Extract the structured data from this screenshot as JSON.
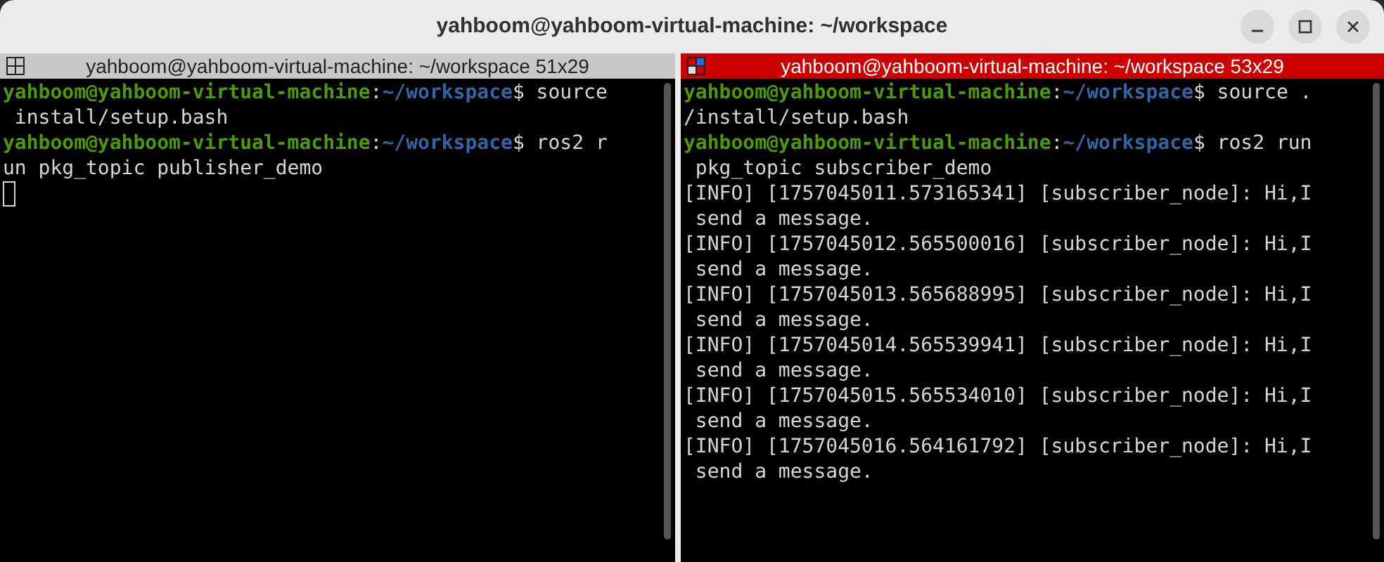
{
  "window": {
    "title": "yahboom@yahboom-virtual-machine: ~/workspace"
  },
  "panes": [
    {
      "title": "yahboom@yahboom-virtual-machine: ~/workspace 51x29",
      "focused": false,
      "cursor": true,
      "lines": [
        [
          {
            "kind": "user",
            "text": "yahboom@yahboom-virtual-machine"
          },
          {
            "kind": "plain",
            "text": ":"
          },
          {
            "kind": "path",
            "text": "~/workspace"
          },
          {
            "kind": "plain",
            "text": "$ source"
          }
        ],
        [
          {
            "kind": "plain",
            "text": " install/setup.bash"
          }
        ],
        [
          {
            "kind": "user",
            "text": "yahboom@yahboom-virtual-machine"
          },
          {
            "kind": "plain",
            "text": ":"
          },
          {
            "kind": "path",
            "text": "~/workspace"
          },
          {
            "kind": "plain",
            "text": "$ ros2 r"
          }
        ],
        [
          {
            "kind": "plain",
            "text": "un pkg_topic publisher_demo"
          }
        ]
      ]
    },
    {
      "title": "yahboom@yahboom-virtual-machine: ~/workspace 53x29",
      "focused": true,
      "lines": [
        [
          {
            "kind": "user",
            "text": "yahboom@yahboom-virtual-machine"
          },
          {
            "kind": "plain",
            "text": ":"
          },
          {
            "kind": "path",
            "text": "~/workspace"
          },
          {
            "kind": "plain",
            "text": "$ source ."
          }
        ],
        [
          {
            "kind": "plain",
            "text": "/install/setup.bash"
          }
        ],
        [
          {
            "kind": "user",
            "text": "yahboom@yahboom-virtual-machine"
          },
          {
            "kind": "plain",
            "text": ":"
          },
          {
            "kind": "path",
            "text": "~/workspace"
          },
          {
            "kind": "plain",
            "text": "$ ros2 run"
          }
        ],
        [
          {
            "kind": "plain",
            "text": " pkg_topic subscriber_demo"
          }
        ],
        [
          {
            "kind": "plain",
            "text": "[INFO] [1757045011.573165341] [subscriber_node]: Hi,I"
          }
        ],
        [
          {
            "kind": "plain",
            "text": " send a message."
          }
        ],
        [
          {
            "kind": "plain",
            "text": "[INFO] [1757045012.565500016] [subscriber_node]: Hi,I"
          }
        ],
        [
          {
            "kind": "plain",
            "text": " send a message."
          }
        ],
        [
          {
            "kind": "plain",
            "text": "[INFO] [1757045013.565688995] [subscriber_node]: Hi,I"
          }
        ],
        [
          {
            "kind": "plain",
            "text": " send a message."
          }
        ],
        [
          {
            "kind": "plain",
            "text": "[INFO] [1757045014.565539941] [subscriber_node]: Hi,I"
          }
        ],
        [
          {
            "kind": "plain",
            "text": " send a message."
          }
        ],
        [
          {
            "kind": "plain",
            "text": "[INFO] [1757045015.565534010] [subscriber_node]: Hi,I"
          }
        ],
        [
          {
            "kind": "plain",
            "text": " send a message."
          }
        ],
        [
          {
            "kind": "plain",
            "text": "[INFO] [1757045016.564161792] [subscriber_node]: Hi,I"
          }
        ],
        [
          {
            "kind": "plain",
            "text": " send a message."
          }
        ]
      ]
    }
  ]
}
